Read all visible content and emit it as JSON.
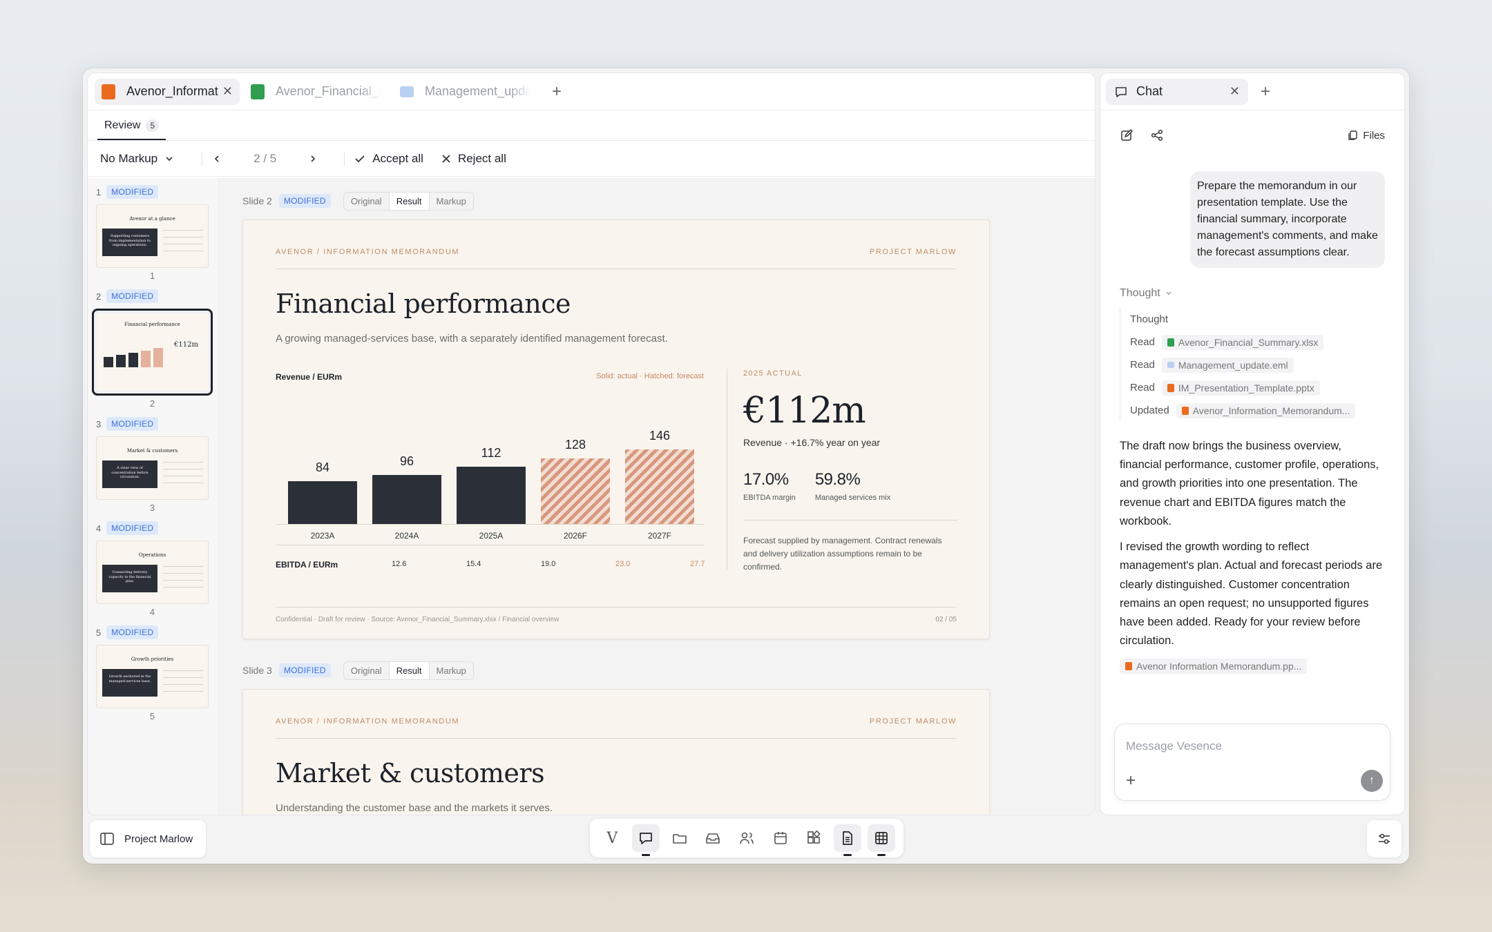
{
  "tabs": [
    {
      "label": "Avenor_Information_Memorandum",
      "type": "ppt"
    },
    {
      "label": "Avenor_Financial_Summary",
      "type": "xls"
    },
    {
      "label": "Management_update",
      "type": "eml"
    }
  ],
  "review": {
    "label": "Review",
    "count": "5"
  },
  "toolbar": {
    "markup": "No Markup",
    "pager": "2 / 5",
    "accept": "Accept all",
    "reject": "Reject all"
  },
  "thumbnails": [
    {
      "num": "1",
      "badge": "MODIFIED",
      "title": "Avenor at a glance",
      "dark": "Supporting customers from implementation to ongoing operations."
    },
    {
      "num": "2",
      "badge": "MODIFIED",
      "title": "Financial performance",
      "dark": ""
    },
    {
      "num": "3",
      "badge": "MODIFIED",
      "title": "Market & customers",
      "dark": "A clear view of concentration before circulation."
    },
    {
      "num": "4",
      "badge": "MODIFIED",
      "title": "Operations",
      "dark": "Connecting delivery capacity to the financial plan."
    },
    {
      "num": "5",
      "badge": "MODIFIED",
      "title": "Growth priorities",
      "dark": "Growth anchored in the managed-services base."
    }
  ],
  "slide_views": {
    "original": "Original",
    "result": "Result",
    "markup": "Markup"
  },
  "slide2": {
    "label": "Slide 2",
    "badge": "MODIFIED",
    "header_left": "AVENOR / INFORMATION MEMORANDUM",
    "header_right": "PROJECT MARLOW",
    "title": "Financial performance",
    "subtitle": "A growing managed-services base, with a separately identified management forecast.",
    "chart_label": "Revenue / EURm",
    "chart_legend": "Solid: actual · Hatched: forecast",
    "ebitda_label": "EBITDA / EURm",
    "right_label": "2025 ACTUAL",
    "big_value": "€112m",
    "revenue_note": "Revenue · +16.7% year on year",
    "stat1_value": "17.0%",
    "stat1_label": "EBITDA margin",
    "stat2_value": "59.8%",
    "stat2_label": "Managed services mix",
    "note": "Forecast supplied by management. Contract renewals and delivery utilization assumptions remain to be confirmed.",
    "footer_left": "Confidential · Draft for review · Source: Avenor_Financial_Summary.xlsx / Financial overview",
    "footer_right": "02 / 05"
  },
  "chart_data": {
    "type": "bar",
    "title": "Revenue / EURm",
    "categories": [
      "2023A",
      "2024A",
      "2025A",
      "2026F",
      "2027F"
    ],
    "values": [
      84,
      96,
      112,
      128,
      146
    ],
    "forecast": [
      false,
      false,
      false,
      true,
      true
    ],
    "ebitda": [
      "12.6",
      "15.4",
      "19.0",
      "23.0",
      "27.7"
    ],
    "colors": {
      "actual": "#2b2f38",
      "forecast": "#d7987e"
    }
  },
  "slide3": {
    "label": "Slide 3",
    "badge": "MODIFIED",
    "header_left": "AVENOR / INFORMATION MEMORANDUM",
    "header_right": "PROJECT MARLOW",
    "title": "Market & customers",
    "subtitle": "Understanding the customer base and the markets it serves."
  },
  "chat": {
    "tab_label": "Chat",
    "files_label": "Files",
    "user_message": "Prepare the memorandum in our presentation template. Use the financial summary, incorporate management's comments, and make the forecast assumptions clear.",
    "thought_toggle": "Thought",
    "thought_title": "Thought",
    "steps": [
      {
        "action": "Read",
        "file": "Avenor_Financial_Summary.xlsx",
        "kind": "x"
      },
      {
        "action": "Read",
        "file": "Management_update.eml",
        "kind": "e"
      },
      {
        "action": "Read",
        "file": "IM_Presentation_Template.pptx",
        "kind": "p"
      },
      {
        "action": "Updated",
        "file": "Avenor_Information_Memorandum...",
        "kind": "p"
      }
    ],
    "reply_p1": "The draft now brings the business overview, financial performance, customer profile, operations, and growth priorities into one presentation. The revenue chart and EBITDA figures match the workbook.",
    "reply_p2": "I revised the growth wording to reflect management's plan. Actual and forecast periods are clearly distinguished. Customer concentration remains an open request; no unsupported figures have been added. Ready for your review before circulation.",
    "attachment": "Avenor Information Memorandum.pp...",
    "composer_placeholder": "Message Vesence"
  },
  "workspace": {
    "name": "Project Marlow"
  },
  "dock": [
    "logo",
    "chat-icon",
    "folder-icon",
    "inbox-icon",
    "people-icon",
    "calendar-icon",
    "apps-icon",
    "document-icon",
    "spreadsheet-icon"
  ]
}
